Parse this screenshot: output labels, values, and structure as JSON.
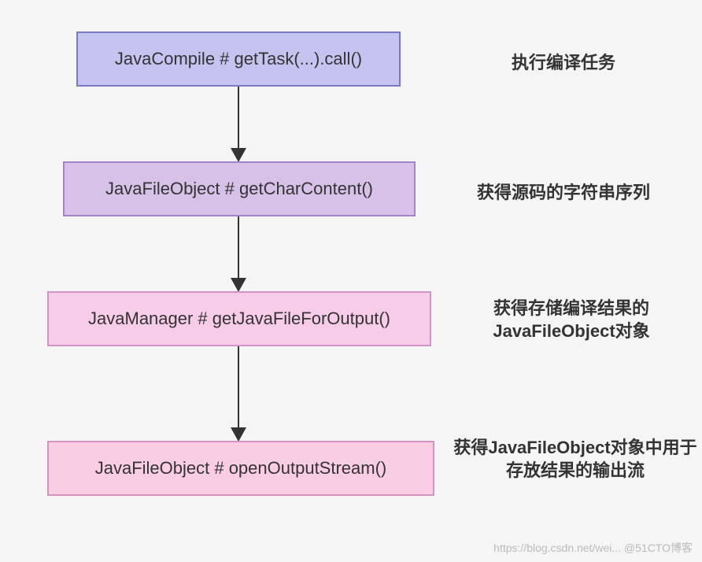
{
  "nodes": [
    {
      "label": "JavaCompile # getTask(...).call()",
      "annotation": "执行编译任务"
    },
    {
      "label": "JavaFileObject # getCharContent()",
      "annotation": "获得源码的字符串序列"
    },
    {
      "label": "JavaManager # getJavaFileForOutput()",
      "annotation": "获得存储编译结果的JavaFileObject对象"
    },
    {
      "label": "JavaFileObject # openOutputStream()",
      "annotation": "获得JavaFileObject对象中用于存放结果的输出流"
    }
  ],
  "watermark": "https://blog.csdn.net/wei... @51CTO博客"
}
